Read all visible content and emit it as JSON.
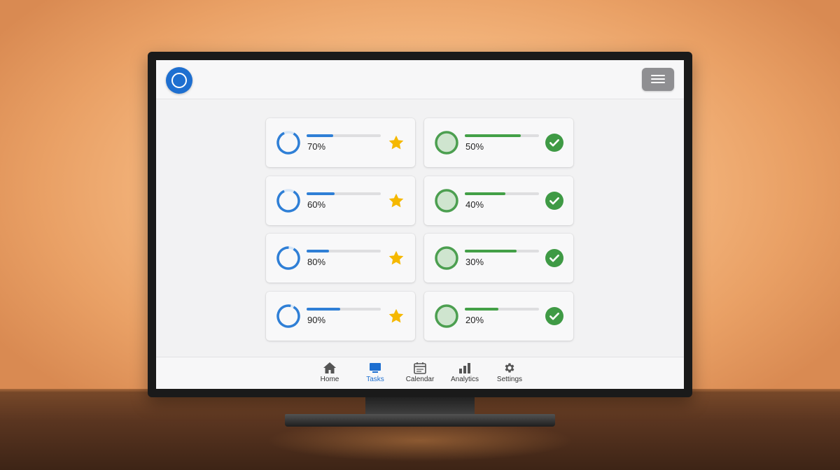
{
  "header": {
    "logo_icon": "circle-logo-icon",
    "menu_icon": "hamburger-menu-icon"
  },
  "colors": {
    "accent": "#1e6fd0",
    "blue_progress": "#2f7fd6",
    "green_progress": "#43a047",
    "star": "#f5b800"
  },
  "cards": {
    "left": [
      {
        "percent_label": "70%",
        "bar_fraction": 0.36,
        "ring_fraction": 0.85,
        "badge_icon": "star-icon"
      },
      {
        "percent_label": "60%",
        "bar_fraction": 0.38,
        "ring_fraction": 0.85,
        "badge_icon": "star-icon"
      },
      {
        "percent_label": "80%",
        "bar_fraction": 0.3,
        "ring_fraction": 0.92,
        "badge_icon": "star-icon"
      },
      {
        "percent_label": "90%",
        "bar_fraction": 0.45,
        "ring_fraction": 0.95,
        "badge_icon": "star-icon"
      }
    ],
    "right": [
      {
        "percent_label": "50%",
        "bar_fraction": 0.75,
        "badge_icon": "check-circle-icon"
      },
      {
        "percent_label": "40%",
        "bar_fraction": 0.55,
        "badge_icon": "check-circle-icon"
      },
      {
        "percent_label": "30%",
        "bar_fraction": 0.7,
        "badge_icon": "check-circle-icon"
      },
      {
        "percent_label": "20%",
        "bar_fraction": 0.45,
        "badge_icon": "check-circle-icon"
      }
    ]
  },
  "bottom_nav": {
    "items": [
      {
        "label": "Home",
        "icon": "home-icon",
        "active": false
      },
      {
        "label": "Tasks",
        "icon": "tasks-icon",
        "active": true
      },
      {
        "label": "Calendar",
        "icon": "calendar-icon",
        "active": false
      },
      {
        "label": "Analytics",
        "icon": "analytics-icon",
        "active": false
      },
      {
        "label": "Settings",
        "icon": "gear-icon",
        "active": false
      }
    ]
  }
}
